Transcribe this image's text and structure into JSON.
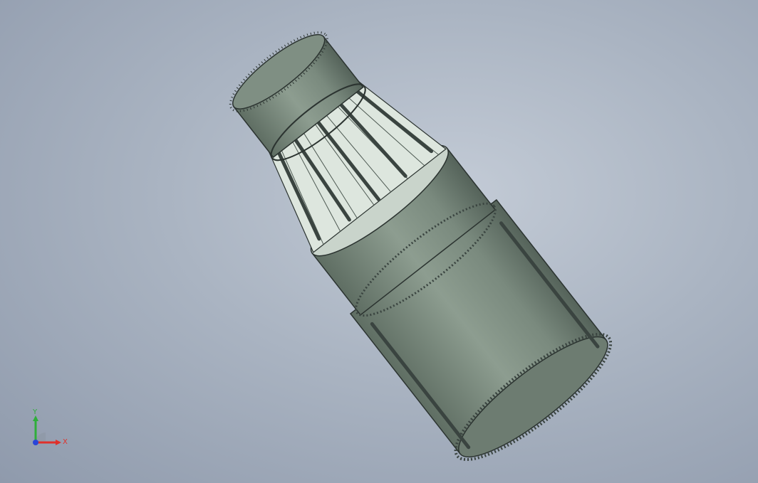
{
  "viewport": {
    "background_top": "#c3cbd6",
    "background_bottom": "#8f9aac",
    "model": "nozzle-assembly",
    "colors": {
      "body": "#7f8f83",
      "body_dark": "#5f6e63",
      "body_light": "#a9b8ac",
      "interior": "#d9e2da",
      "edge": "#2b3330"
    }
  },
  "triad": {
    "x_label": "X",
    "y_label": "Y",
    "x_color": "#e0302a",
    "y_color": "#2fae3a",
    "z_color": "#2a45d8"
  }
}
